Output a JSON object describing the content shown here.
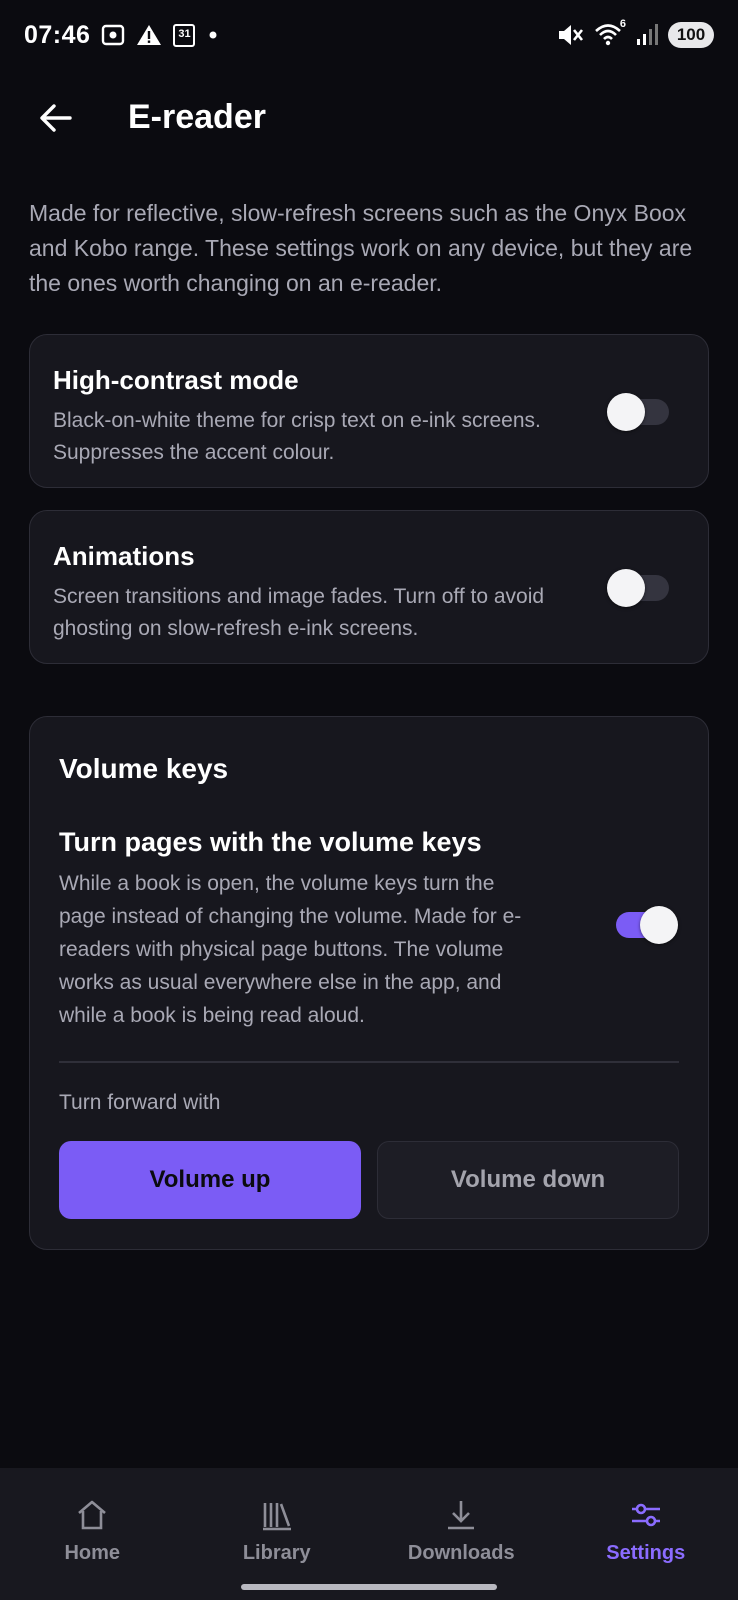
{
  "status_bar": {
    "time": "07:46",
    "calendar_day": "31",
    "battery": "100",
    "wifi_badge": "6",
    "icons": [
      "screenshot-icon",
      "warning-icon",
      "calendar-icon",
      "dot-icon",
      "mute-icon",
      "wifi-icon",
      "signal-icon",
      "battery-icon"
    ]
  },
  "app_bar": {
    "back_icon": "back-arrow-icon",
    "title": "E-reader"
  },
  "intro": "Made for reflective, slow-refresh screens such as the Onyx Boox and Kobo range. These settings work on any device, but they are the ones worth changing on an e-reader.",
  "settings": {
    "high_contrast": {
      "title": "High-contrast mode",
      "description": "Black-on-white theme for crisp text on e-ink screens. Suppresses the accent colour.",
      "enabled": false
    },
    "animations": {
      "title": "Animations",
      "description": "Screen transitions and image fades. Turn off to avoid ghosting on slow-refresh e-ink screens.",
      "enabled": false
    },
    "volume_keys": {
      "section_title": "Volume keys",
      "title": "Turn pages with the volume keys",
      "description": "While a book is open, the volume keys turn the page instead of changing the volume. Made for e-readers with physical page buttons. The volume works as usual everywhere else in the app, and while a book is being read aloud.",
      "enabled": true,
      "forward_label": "Turn forward with",
      "options": [
        "Volume up",
        "Volume down"
      ],
      "selected": "Volume up"
    }
  },
  "bottom_nav": {
    "items": [
      {
        "label": "Home",
        "icon": "home-icon",
        "active": false
      },
      {
        "label": "Library",
        "icon": "library-icon",
        "active": false
      },
      {
        "label": "Downloads",
        "icon": "download-icon",
        "active": false
      },
      {
        "label": "Settings",
        "icon": "settings-sliders-icon",
        "active": true
      }
    ]
  },
  "colors": {
    "background": "#0b0b10",
    "card": "#17171e",
    "accent": "#7b5cf5",
    "nav_active": "#8b6cff",
    "text_muted": "#a9a9b5"
  }
}
